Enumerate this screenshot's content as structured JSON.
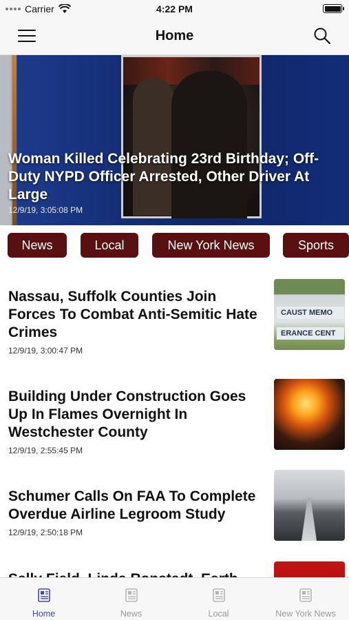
{
  "status_bar": {
    "carrier": "Carrier",
    "time": "4:22 PM"
  },
  "nav": {
    "title": "Home",
    "menu_icon": "hamburger-menu-icon",
    "search_icon": "search-icon"
  },
  "hero": {
    "title": "Woman Killed Celebrating 23rd Birthday; Off-Duty NYPD Officer Arrested, Other Driver At Large",
    "timestamp": "12/9/19, 3:05:08 PM"
  },
  "categories": [
    "News",
    "Local",
    "New York News",
    "Sports"
  ],
  "articles": [
    {
      "title": "Nassau, Suffolk Counties Join Forces To Combat Anti-Semitic Hate Crimes",
      "timestamp": "12/9/19, 3:00:47 PM",
      "thumb_text": [
        "CAUST MEMO",
        "ERANCE CENT"
      ]
    },
    {
      "title": "Building Under Construction Goes Up In Flames Overnight In Westchester County",
      "timestamp": "12/9/19, 2:55:45 PM"
    },
    {
      "title": "Schumer Calls On FAA To Complete Overdue Airline Legroom Study",
      "timestamp": "12/9/19, 2:50:18 PM"
    },
    {
      "title": "Sally Field, Linda Ronstadt, Earth"
    }
  ],
  "tabs": [
    {
      "label": "Home",
      "active": true
    },
    {
      "label": "News",
      "active": false
    },
    {
      "label": "Local",
      "active": false
    },
    {
      "label": "New York News",
      "active": false
    }
  ],
  "colors": {
    "chip_background": "#5a1010",
    "tab_active": "#3e47c8",
    "tab_inactive": "#9a9a9a"
  }
}
